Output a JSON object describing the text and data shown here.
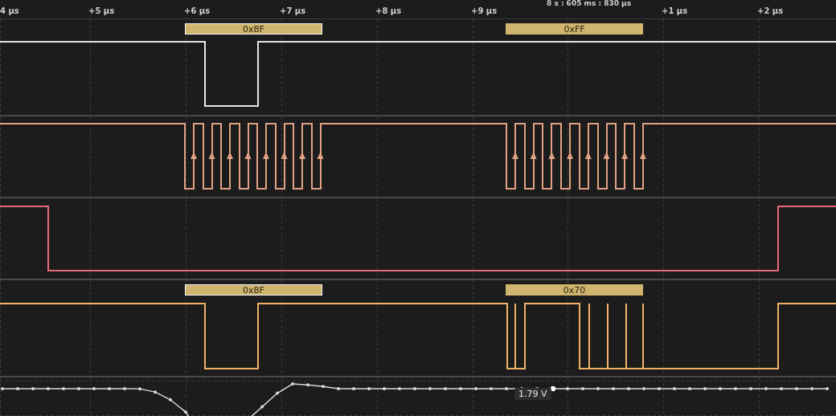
{
  "timeline": {
    "cursor_time": "8 s : 605 ms : 830 µs",
    "ticks": [
      "4 µs",
      "+5 µs",
      "+6 µs",
      "+7 µs",
      "+8 µs",
      "+9 µs",
      "+1 µs",
      "+2 µs"
    ]
  },
  "channels": [
    {
      "kind": "digital",
      "color": "#e6e6e6",
      "decoded": [
        {
          "label": "0x8F"
        },
        {
          "label": "0xFF"
        }
      ]
    },
    {
      "kind": "clock",
      "color": "#e0a284"
    },
    {
      "kind": "digital",
      "color": "#e86a78"
    },
    {
      "kind": "digital",
      "color": "#f2b266",
      "decoded": [
        {
          "label": "0x8F"
        },
        {
          "label": "0x70"
        }
      ]
    },
    {
      "kind": "analog",
      "color": "#d8d8d8",
      "cursor_reading": "1.79 V"
    }
  ]
}
